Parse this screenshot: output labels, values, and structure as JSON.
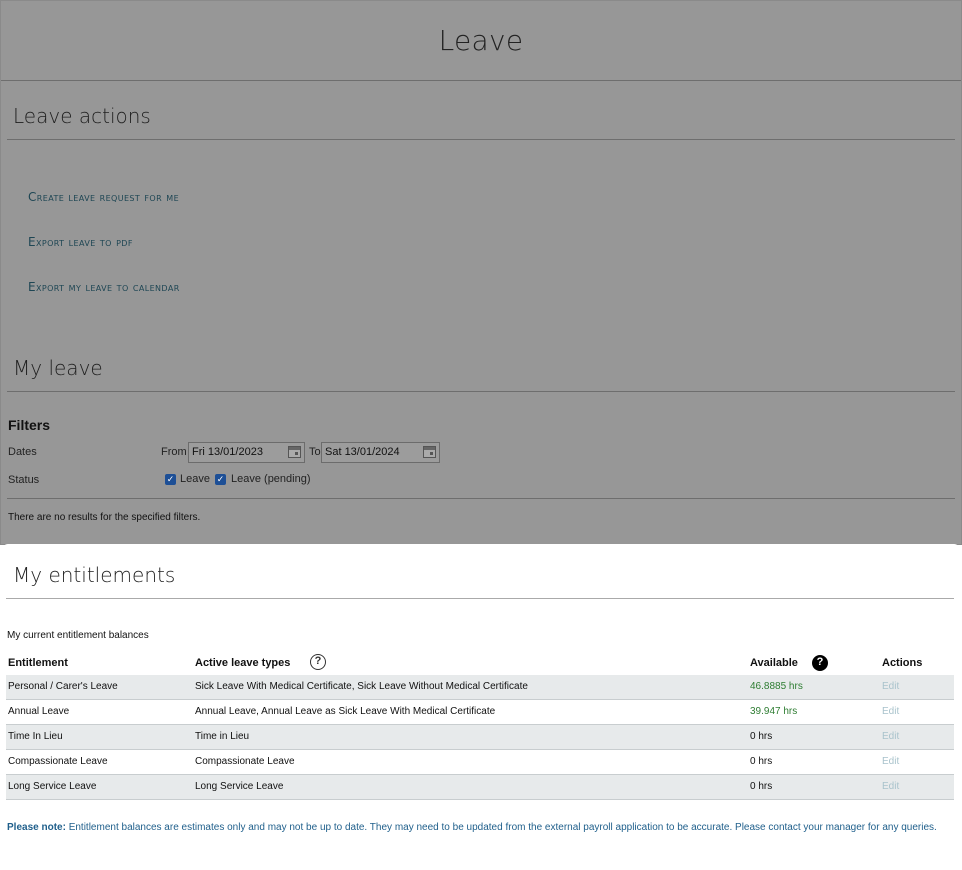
{
  "page": {
    "title": "Leave"
  },
  "leave_actions": {
    "heading": "Leave actions",
    "links": [
      "Create leave request for me",
      "Export leave to pdf",
      "Export my leave to calendar"
    ]
  },
  "my_leave": {
    "heading": "My leave",
    "filters": {
      "title": "Filters",
      "dates_label": "Dates",
      "from_label": "From",
      "from_value": "Fri 13/01/2023",
      "to_label": "To",
      "to_value": "Sat 13/01/2024",
      "status_label": "Status",
      "status_options": [
        {
          "label": "Leave",
          "checked": true
        },
        {
          "label": "Leave (pending)",
          "checked": true
        }
      ]
    },
    "no_results": "There are no results for the specified filters."
  },
  "entitlements": {
    "heading": "My entitlements",
    "caption": "My current entitlement balances",
    "columns": {
      "entitlement": "Entitlement",
      "active_types": "Active leave types",
      "available": "Available",
      "actions": "Actions"
    },
    "rows": [
      {
        "entitlement": "Personal / Carer's Leave",
        "types": "Sick Leave With Medical Certificate, Sick Leave Without Medical Certificate",
        "available": "46.8885 hrs",
        "action": "Edit"
      },
      {
        "entitlement": "Annual Leave",
        "types": "Annual Leave, Annual Leave as Sick Leave With Medical Certificate",
        "available": "39.947 hrs",
        "action": "Edit"
      },
      {
        "entitlement": "Time In Lieu",
        "types": "Time in Lieu",
        "available": "0 hrs",
        "action": "Edit"
      },
      {
        "entitlement": "Compassionate Leave",
        "types": "Compassionate Leave",
        "available": "0 hrs",
        "action": "Edit"
      },
      {
        "entitlement": "Long Service Leave",
        "types": "Long Service Leave",
        "available": "0 hrs",
        "action": "Edit"
      }
    ],
    "note_label": "Please note:",
    "note_text": " Entitlement balances are estimates only and may not be up to date. They may need to be updated from the external payroll application to be accurate. Please contact your manager for any queries."
  },
  "icons": {
    "calendar": "calendar-icon",
    "help": "help-icon"
  },
  "colors": {
    "overlay": "#979797",
    "link": "#1e4654",
    "positive_balance": "#2e7d32",
    "note": "#1f5f8b",
    "row_shade": "#e7eaeb"
  }
}
